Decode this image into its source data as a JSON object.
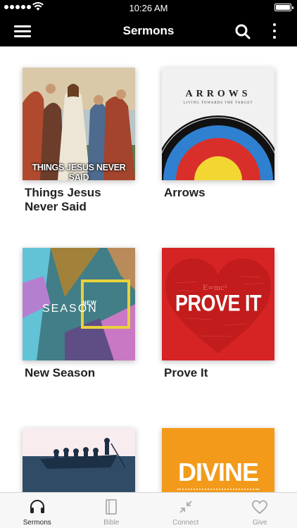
{
  "status_bar": {
    "time": "10:26 AM"
  },
  "nav": {
    "title": "Sermons",
    "icons": [
      "menu-icon",
      "search-icon",
      "more-vertical-icon"
    ]
  },
  "sermons": [
    {
      "title": "Things Jesus Never Said",
      "art_text": "THINGS JESUS NEVER SAID"
    },
    {
      "title": "Arrows",
      "art_text": "ARROWS",
      "art_subtext": "LIVING TOWARDS THE TARGET"
    },
    {
      "title": "New Season",
      "art_text": "SEASON",
      "art_subtext": "NEW"
    },
    {
      "title": "Prove It",
      "art_text": "PROVE IT",
      "art_subtext": "E=mc²"
    },
    {
      "title": "",
      "art_text": ""
    },
    {
      "title": "",
      "art_text": "DIVINE"
    }
  ],
  "tabs": [
    {
      "label": "Sermons",
      "icon": "headphones-icon",
      "active": true
    },
    {
      "label": "Bible",
      "icon": "book-icon",
      "active": false
    },
    {
      "label": "Connect",
      "icon": "connect-arrows-icon",
      "active": false
    },
    {
      "label": "Give",
      "icon": "heart-icon",
      "active": false
    }
  ],
  "colors": {
    "bar_bg": "#000000",
    "accent": "#000000",
    "tab_inactive": "#999999"
  }
}
